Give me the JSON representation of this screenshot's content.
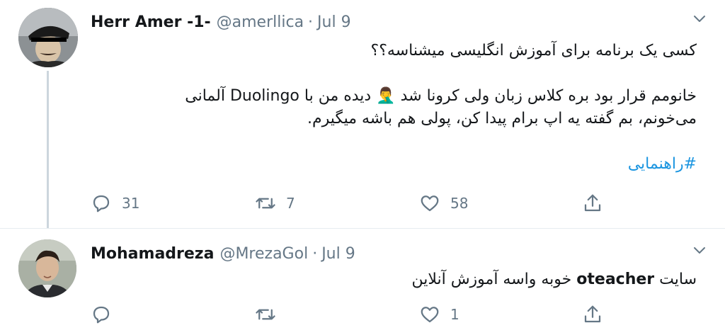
{
  "tweets": [
    {
      "display_name": "Herr Amer -1-",
      "handle": "@amerllica",
      "separator": "·",
      "date": "Jul 9",
      "avatar_icon": "avatar-military-cap-icon",
      "body": {
        "line1": "کسی یک برنامه برای آموزش انگلیسی میشناسه؟؟",
        "line2": "خانومم قرار بود بره کلاس زبان ولی کرونا شد 🤦‍♂️ دیده من با Duolingo آلمانی",
        "line3": "می‌خونم، بم گفته یه اپ برام پیدا کن، پولی هم باشه میگیرم.",
        "hashtag": "#راهنمایی"
      },
      "actions": {
        "reply_count": "31",
        "retweet_count": "7",
        "like_count": "58"
      }
    },
    {
      "display_name": "Mohamadreza",
      "handle": "@MrezaGol",
      "separator": "·",
      "date": "Jul 9",
      "avatar_icon": "avatar-photo-icon",
      "body": {
        "prefix": "سایت ",
        "bold": "oteacher",
        "suffix": " خوبه واسه آموزش آنلاین"
      },
      "actions": {
        "reply_count": "",
        "retweet_count": "",
        "like_count": "1"
      }
    }
  ],
  "colors": {
    "text": "#14171a",
    "muted": "#657786",
    "link": "#1b95e0",
    "divider": "#e6ecf0",
    "thread_line": "#ccd6dd"
  },
  "icons": [
    "reply-icon",
    "retweet-icon",
    "like-icon",
    "share-icon",
    "chevron-down-icon"
  ]
}
